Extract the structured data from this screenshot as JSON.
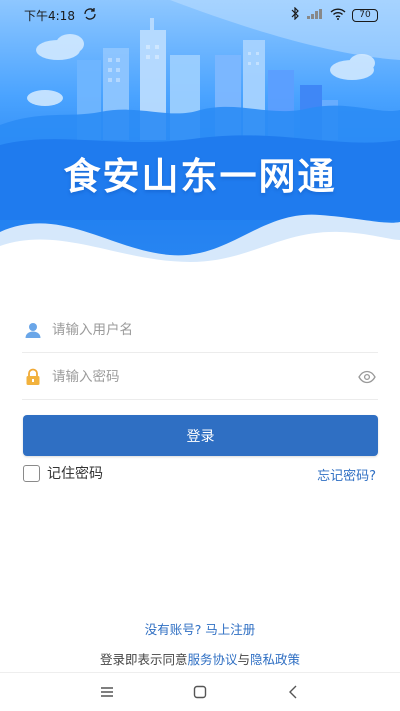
{
  "status_bar": {
    "time": "下午4:18",
    "battery": "70"
  },
  "app": {
    "title": "食安山东一网通"
  },
  "login": {
    "username_placeholder": "请输入用户名",
    "password_placeholder": "请输入密码",
    "login_button": "登录",
    "remember_label": "记住密码",
    "forgot_link": "忘记密码?"
  },
  "footer": {
    "register_text": "没有账号? 马上注册",
    "agreement_prefix": "登录即表示同意",
    "service_agreement": "服务协议",
    "conjunction": "与",
    "privacy_policy": "隐私政策"
  },
  "icons": {
    "user": "user-icon",
    "lock": "lock-icon",
    "eye": "eye-icon",
    "menu": "menu-icon",
    "home": "home-icon",
    "back": "back-icon"
  },
  "colors": {
    "accent": "#2f6fc3",
    "hero_blue": "#1f7ff0"
  }
}
